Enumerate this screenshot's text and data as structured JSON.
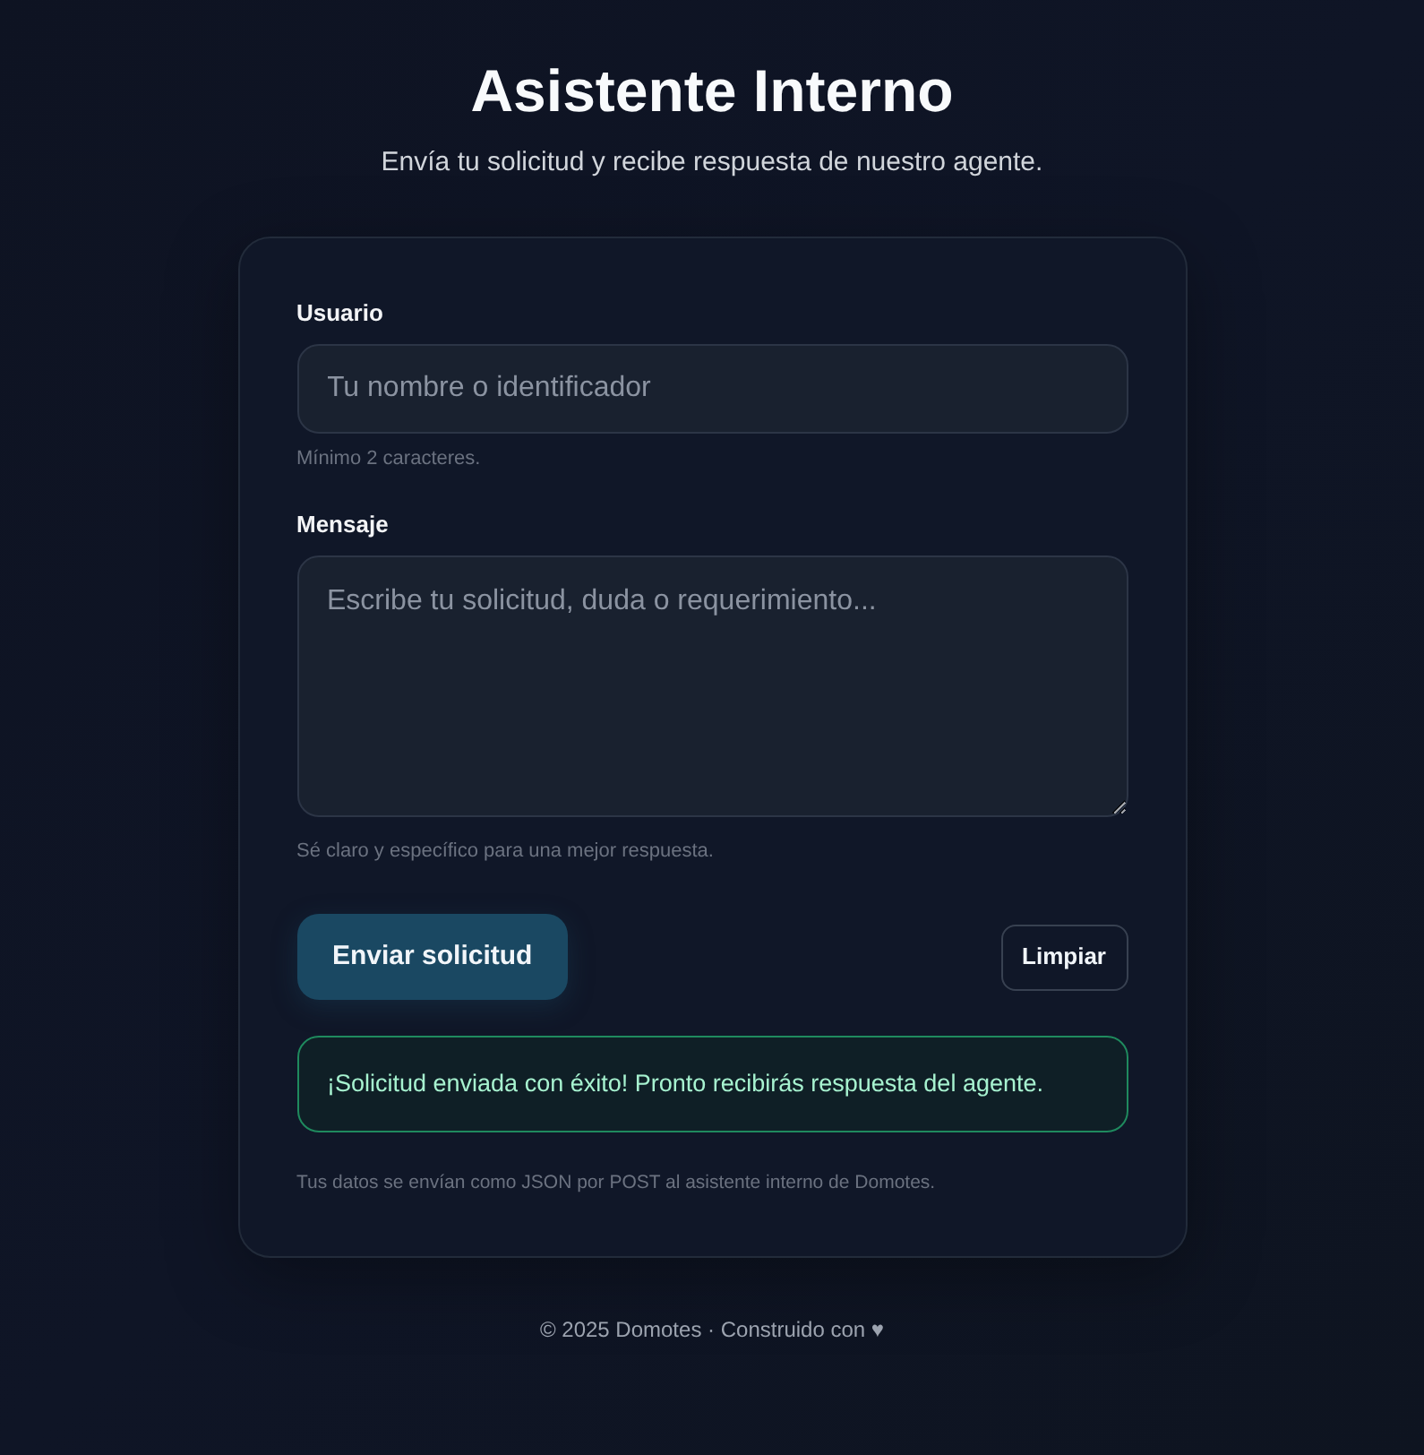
{
  "header": {
    "title": "Asistente Interno",
    "subtitle": "Envía tu solicitud y recibe respuesta de nuestro agente."
  },
  "form": {
    "fields": [
      {
        "kind": "input",
        "label": "Usuario",
        "placeholder": "Tu nombre o identificador",
        "hint": "Mínimo 2 caracteres."
      },
      {
        "kind": "textarea",
        "label": "Mensaje",
        "placeholder": "Escribe tu solicitud, duda o requerimiento...",
        "hint": "Sé claro y específico para una mejor respuesta."
      }
    ],
    "buttons": [
      {
        "kind": "primary",
        "label": "Enviar solicitud"
      },
      {
        "kind": "secondary",
        "label": "Limpiar"
      }
    ],
    "alert": {
      "kind": "success",
      "text": "¡Solicitud enviada con éxito! Pronto recibirás respuesta del agente."
    },
    "note": "Tus datos se envían como JSON por POST al asistente interno de Domotes."
  },
  "footer": {
    "text": "© 2025 Domotes · Construido con ♥"
  }
}
